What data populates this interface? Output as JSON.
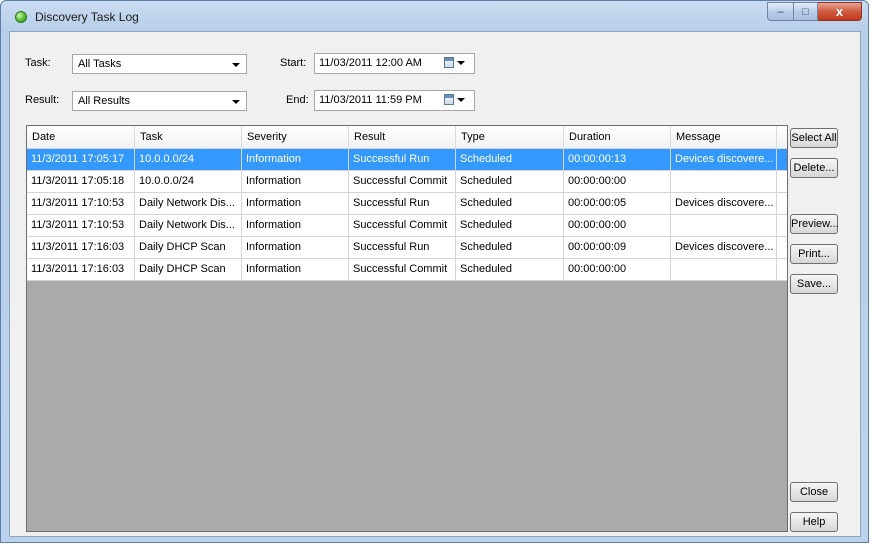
{
  "window": {
    "title": "Discovery Task Log",
    "controls": {
      "minimize": "–",
      "maximize": "□",
      "close": "x"
    }
  },
  "filters": {
    "task_label": "Task:",
    "task_value": "All Tasks",
    "result_label": "Result:",
    "result_value": "All Results",
    "start_label": "Start:",
    "start_value": "11/03/2011 12:00 AM",
    "end_label": "End:",
    "end_value": "11/03/2011 11:59 PM"
  },
  "table": {
    "columns": [
      "Date",
      "Task",
      "Severity",
      "Result",
      "Type",
      "Duration",
      "Message"
    ],
    "rows": [
      [
        "11/3/2011 17:05:17",
        "10.0.0.0/24",
        "Information",
        "Successful Run",
        "Scheduled",
        "00:00:00:13",
        "Devices discovere..."
      ],
      [
        "11/3/2011 17:05:18",
        "10.0.0.0/24",
        "Information",
        "Successful Commit",
        "Scheduled",
        "00:00:00:00",
        ""
      ],
      [
        "11/3/2011 17:10:53",
        "Daily Network Dis...",
        "Information",
        "Successful Run",
        "Scheduled",
        "00:00:00:05",
        "Devices discovere..."
      ],
      [
        "11/3/2011 17:10:53",
        "Daily Network Dis...",
        "Information",
        "Successful Commit",
        "Scheduled",
        "00:00:00:00",
        ""
      ],
      [
        "11/3/2011 17:16:03",
        "Daily DHCP Scan",
        "Information",
        "Successful Run",
        "Scheduled",
        "00:00:00:09",
        "Devices discovere..."
      ],
      [
        "11/3/2011 17:16:03",
        "Daily DHCP Scan",
        "Information",
        "Successful Commit",
        "Scheduled",
        "00:00:00:00",
        ""
      ]
    ],
    "selected_row": 0
  },
  "buttons": {
    "select_all": "Select All",
    "delete": "Delete...",
    "preview": "Preview...",
    "print": "Print...",
    "save": "Save...",
    "close": "Close",
    "help": "Help"
  },
  "colors": {
    "selection": "#3399ff",
    "grid_background": "#aaaaaa",
    "dialog_background": "#f0f0f0"
  }
}
